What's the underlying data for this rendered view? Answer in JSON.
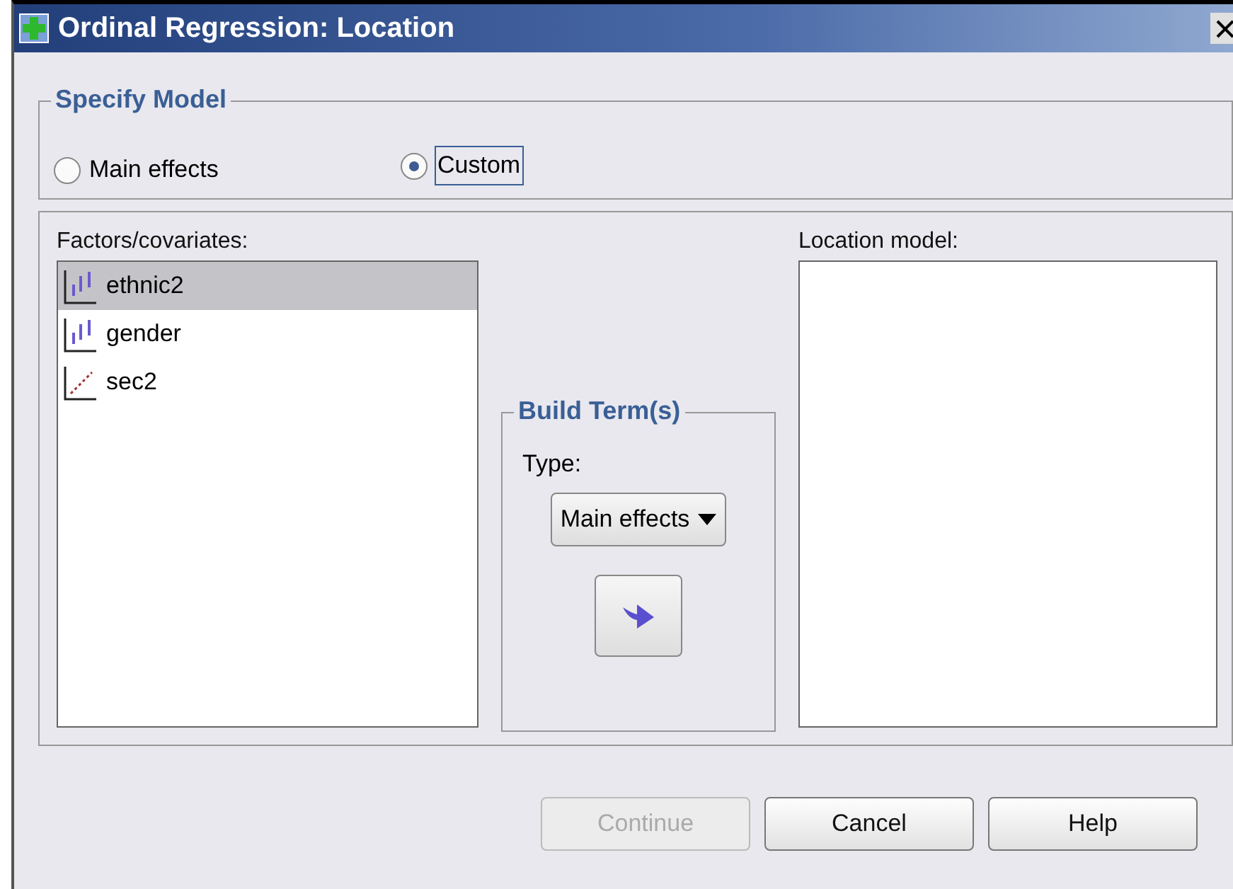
{
  "window": {
    "title": "Ordinal Regression: Location"
  },
  "specify_model": {
    "title": "Specify Model",
    "options": [
      {
        "label": "Main effects",
        "selected": false
      },
      {
        "label": "Custom",
        "selected": true
      }
    ]
  },
  "factors": {
    "label": "Factors/covariates:",
    "items": [
      {
        "name": "ethnic2",
        "kind": "nominal",
        "selected": true
      },
      {
        "name": "gender",
        "kind": "nominal",
        "selected": false
      },
      {
        "name": "sec2",
        "kind": "scale",
        "selected": false
      }
    ]
  },
  "build_terms": {
    "title": "Build Term(s)",
    "type_label": "Type:",
    "type_value": "Main effects"
  },
  "location_model": {
    "label": "Location model:"
  },
  "buttons": [
    {
      "label": "Continue",
      "disabled": true
    },
    {
      "label": "Cancel",
      "disabled": false
    },
    {
      "label": "Help",
      "disabled": false
    }
  ]
}
